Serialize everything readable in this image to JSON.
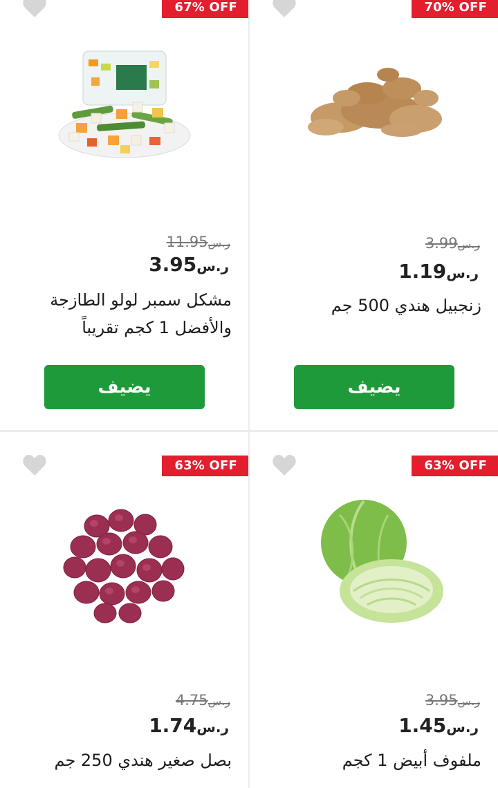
{
  "products": [
    {
      "badge": "67% OFF",
      "old_price": "11.95",
      "price": "3.95",
      "currency": "ر.س",
      "title_line1": "مشكل سمبر لولو الطازجة",
      "title_line2": "والأفضل 1 كجم تقريباً",
      "add_label": "يضيف",
      "image": "mixed-vegetables"
    },
    {
      "badge": "70% OFF",
      "old_price": "3.99",
      "price": "1.19",
      "currency": "ر.س",
      "title_line1": "زنجبيل هندي 500 جم",
      "add_label": "يضيف",
      "image": "ginger"
    },
    {
      "badge": "63% OFF",
      "old_price": "4.75",
      "price": "1.74",
      "currency": "ر.س",
      "title_line1": "بصل صغير هندي 250 جم",
      "image": "red-shallots"
    },
    {
      "badge": "63% OFF",
      "old_price": "3.95",
      "price": "1.45",
      "currency": "ر.س",
      "title_line1": "ملفوف أبيض 1 كجم",
      "image": "white-cabbage"
    }
  ],
  "colors": {
    "badge": "#e31e2e",
    "add_button": "#1f9a3b",
    "heart": "#d6d6d6"
  }
}
